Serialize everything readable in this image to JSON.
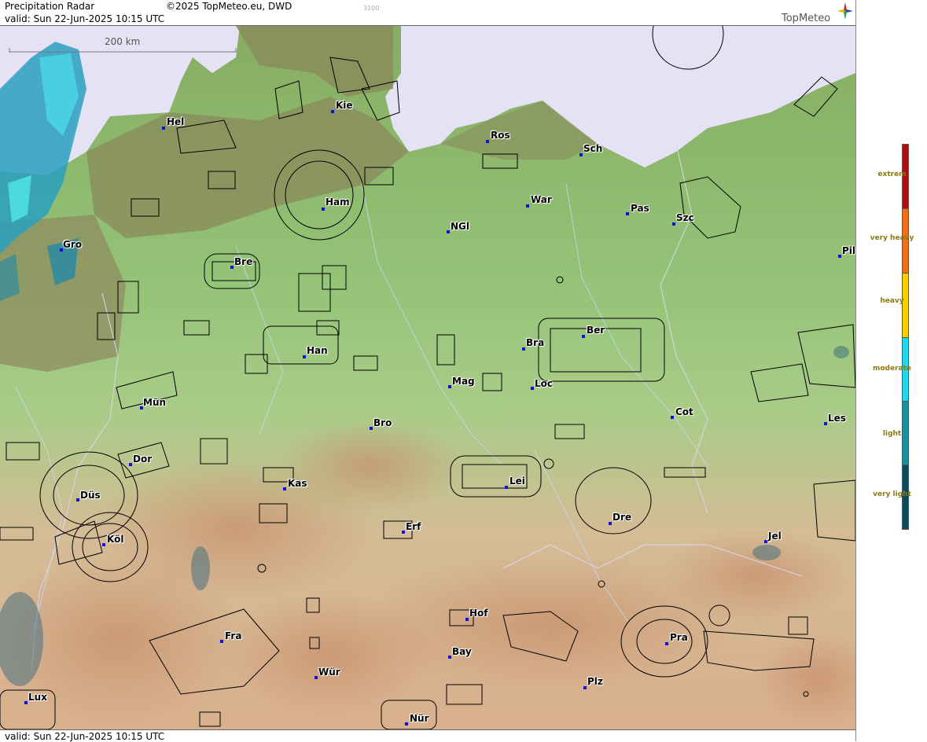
{
  "header": {
    "title": "Precipitation Radar",
    "copyright": "©2025 TopMeteo.eu, DWD",
    "valid": "valid:  Sun  22-Jun-2025 10:15 UTC",
    "small_code": "3100",
    "logo": "TopMeteo"
  },
  "map": {
    "scale_label": "200 km",
    "cities": [
      "Hel",
      "Kie",
      "Ros",
      "Sch",
      "Ham",
      "War",
      "Pas",
      "Szc",
      "NGl",
      "Gro",
      "Bre",
      "Pil",
      "Ber",
      "Bra",
      "Han",
      "Mag",
      "Loc",
      "Mün",
      "Cot",
      "Les",
      "Bro",
      "Dor",
      "Kas",
      "Lei",
      "Düs",
      "Dre",
      "Erf",
      "Köl",
      "Jel",
      "Hof",
      "Fra",
      "Pra",
      "Bay",
      "Wür",
      "Plz",
      "Lux",
      "Nür"
    ]
  },
  "footer": {
    "valid": "valid:  Sun  22-Jun-2025 10:15 UTC"
  },
  "legend": {
    "items": [
      {
        "label": "extrem",
        "color": "#aa1010"
      },
      {
        "label": "very heavy",
        "color": "#f07018"
      },
      {
        "label": "heavy",
        "color": "#f8d000"
      },
      {
        "label": "moderate",
        "color": "#20d8e8"
      },
      {
        "label": "light",
        "color": "#1890a0"
      },
      {
        "label": "very light",
        "color": "#104860"
      }
    ]
  }
}
